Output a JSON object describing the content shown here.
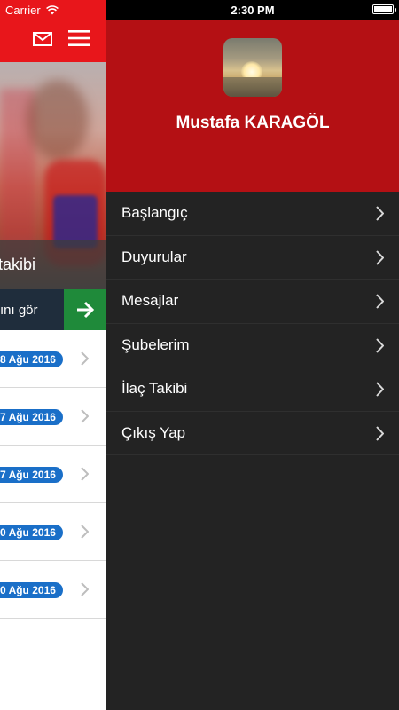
{
  "status_bar": {
    "carrier": "Carrier",
    "time": "2:30 PM",
    "battery_level": 1.0
  },
  "left_page": {
    "hero_caption": "takibi",
    "see_all_label": "ını gör",
    "notices": [
      {
        "date": "8 Ağu 2016"
      },
      {
        "date": "7 Ağu 2016"
      },
      {
        "date": "7 Ağu 2016"
      },
      {
        "date": "0 Ağu 2016"
      },
      {
        "date": "0 Ağu 2016"
      }
    ],
    "icons": {
      "mail": "mail-icon",
      "menu": "hamburger-menu-icon",
      "see_all": "arrow-right-icon"
    }
  },
  "drawer": {
    "user_name": "Mustafa KARAGÖL",
    "items": [
      {
        "label": "Başlangıç"
      },
      {
        "label": "Duyurular"
      },
      {
        "label": "Mesajlar"
      },
      {
        "label": "Şubelerim"
      },
      {
        "label": "İlaç Takibi"
      },
      {
        "label": "Çıkış Yap"
      }
    ]
  },
  "colors": {
    "brand_red": "#e8161b",
    "drawer_header_red": "#b41014",
    "drawer_background": "#232323",
    "badge_blue": "#1a6fc8",
    "action_green": "#1f8a3a",
    "navy": "#1f2d3c"
  }
}
